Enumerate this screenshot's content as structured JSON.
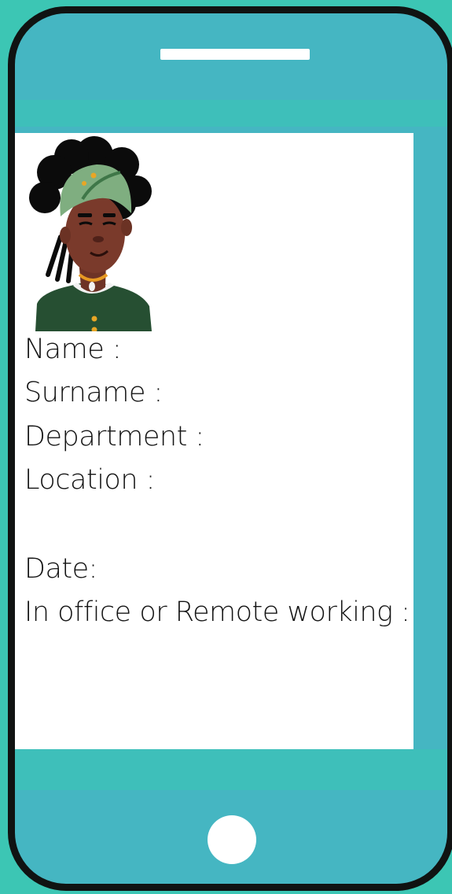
{
  "phone": {
    "accent_color": "#45b6c2",
    "frame_color": "#101312",
    "background_color": "#3cc6b4"
  },
  "profile": {
    "avatar_icon": "avatar-woman-headwrap-icon"
  },
  "fields": {
    "name_label": "Name :",
    "surname_label": "Surname :",
    "department_label": "Department :",
    "location_label": "Location :",
    "date_label": "Date:",
    "work_mode_label": "In office or Remote working :"
  }
}
